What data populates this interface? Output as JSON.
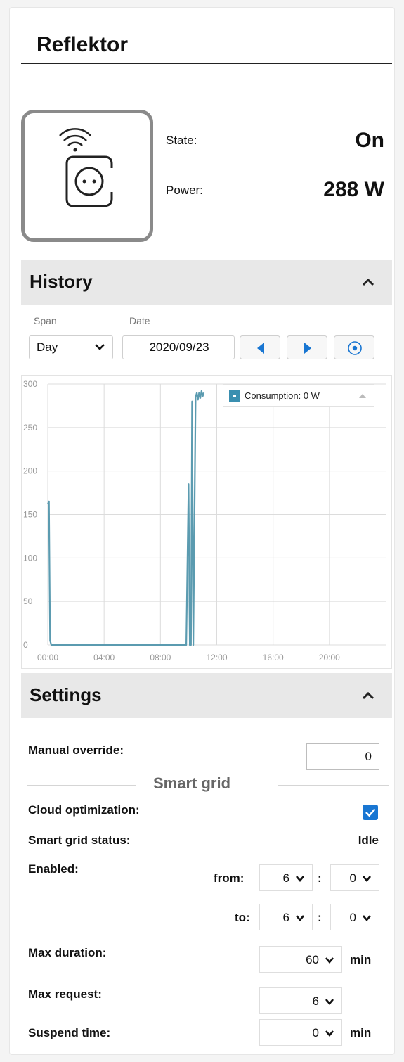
{
  "device": {
    "name": "Reflektor",
    "state_label": "State:",
    "state_value": "On",
    "power_label": "Power:",
    "power_value": "288 W",
    "icon": "smart-plug-wifi-icon"
  },
  "history": {
    "title": "History",
    "span_label": "Span",
    "span_value": "Day",
    "date_label": "Date",
    "date_value": "2020/09/23",
    "legend_label": "Consumption: 0 W",
    "colors": {
      "series": "#5b9bb0",
      "legend_swatch": "#3a8fb0"
    }
  },
  "chart_data": {
    "type": "line",
    "title": "",
    "xlabel": "",
    "ylabel": "",
    "xlim": [
      "00:00",
      "24:00"
    ],
    "ylim": [
      0,
      300
    ],
    "grid": true,
    "legend_placement": "top-right",
    "x_ticks": [
      "00:00",
      "04:00",
      "08:00",
      "12:00",
      "16:00",
      "20:00"
    ],
    "y_ticks": [
      "0",
      "50",
      "100",
      "150",
      "200",
      "250",
      "300"
    ],
    "series": [
      {
        "name": "Consumption",
        "x": [
          "00:00",
          "00:05",
          "00:10",
          "00:15",
          "01:00",
          "04:00",
          "08:00",
          "09:50",
          "10:00",
          "10:05",
          "10:10",
          "10:15",
          "10:20",
          "10:30",
          "10:35",
          "10:40",
          "10:45",
          "10:50",
          "10:55",
          "11:00",
          "11:05"
        ],
        "y": [
          162,
          165,
          5,
          0,
          0,
          0,
          0,
          0,
          185,
          0,
          0,
          280,
          0,
          285,
          290,
          282,
          290,
          284,
          292,
          286,
          290
        ]
      }
    ]
  },
  "settings": {
    "title": "Settings",
    "manual_override_label": "Manual override:",
    "manual_override_value": "0",
    "smart_grid_title": "Smart grid",
    "cloud_opt_label": "Cloud optimization:",
    "cloud_opt_checked": true,
    "status_label": "Smart grid status:",
    "status_value": "Idle",
    "enabled_label": "Enabled:",
    "from_label": "from:",
    "to_label": "to:",
    "from_hour": "6",
    "from_min": "0",
    "to_hour": "6",
    "to_min": "0",
    "colon": ":",
    "max_duration_label": "Max duration:",
    "max_duration_value": "60",
    "max_request_label": "Max request:",
    "max_request_value": "6",
    "suspend_label": "Suspend time:",
    "suspend_value": "0",
    "unit_min": "min"
  },
  "colors": {
    "accent": "#1976d2",
    "header_bg": "#e8e8e8"
  }
}
